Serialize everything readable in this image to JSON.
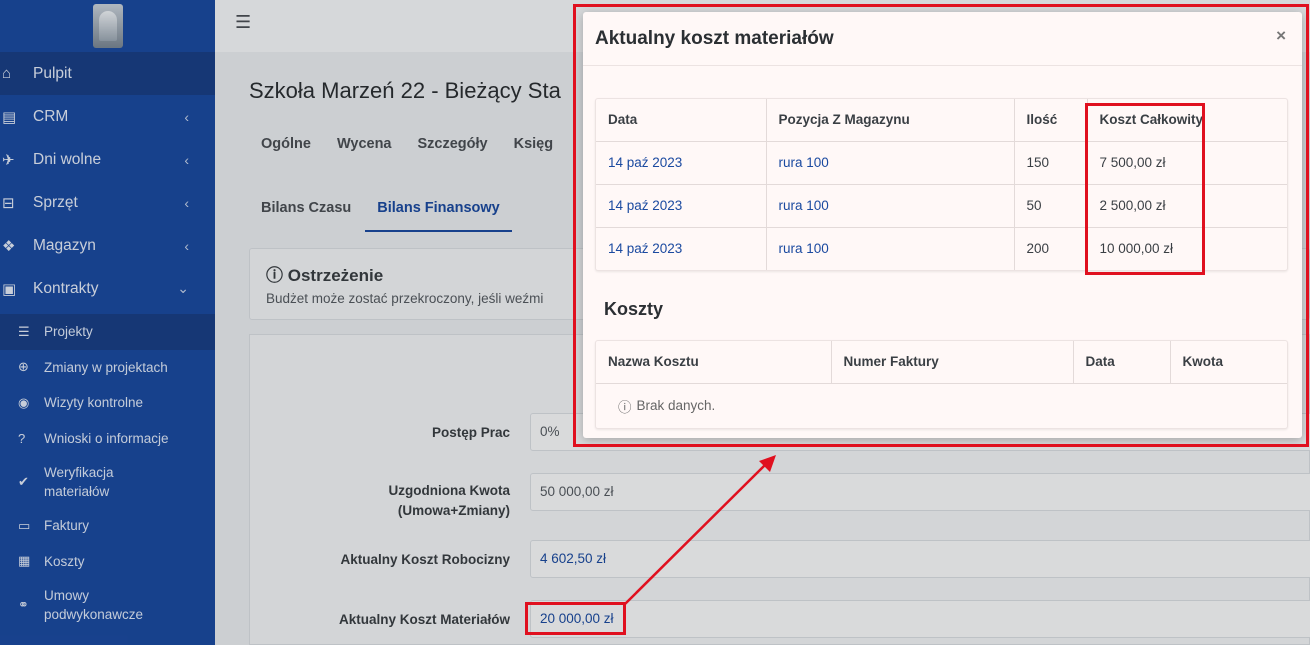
{
  "sidebar": {
    "items": [
      {
        "label": "Pulpit",
        "icon": "home-icon"
      },
      {
        "label": "CRM",
        "icon": "address-card-icon"
      },
      {
        "label": "Dni wolne",
        "icon": "plane-icon"
      },
      {
        "label": "Sprzęt",
        "icon": "hdd-icon"
      },
      {
        "label": "Magazyn",
        "icon": "cubes-icon"
      },
      {
        "label": "Kontrakty",
        "icon": "briefcase-icon"
      }
    ],
    "subitems": [
      {
        "label": "Projekty",
        "icon": "list-icon"
      },
      {
        "label": "Zmiany w projektach",
        "icon": "plus-circle-icon"
      },
      {
        "label": "Wizyty kontrolne",
        "icon": "eye-icon"
      },
      {
        "label": "Wnioski o informacje",
        "icon": "question-circle-icon"
      },
      {
        "label_1": "Weryfikacja",
        "label_2": "materiałów",
        "icon": "check-icon"
      },
      {
        "label": "Faktury",
        "icon": "money-icon"
      },
      {
        "label": "Koszty",
        "icon": "calculator-icon"
      },
      {
        "label_1": "Umowy",
        "label_2": "podwykonawcze",
        "icon": "handshake-icon"
      }
    ]
  },
  "page": {
    "title": "Szkoła Marzeń 22 - Bieżący Sta",
    "tabs1": [
      "Ogólne",
      "Wycena",
      "Szczegóły",
      "Księg"
    ],
    "tabs2": [
      "Bilans Czasu",
      "Bilans Finansowy"
    ],
    "warning": {
      "title": "Ostrzeżenie",
      "text": "Budżet może zostać przekroczony, jeśli weźmi"
    },
    "form": {
      "progress_label": "Postęp Prac",
      "progress_value": "0%",
      "agreed_label_1": "Uzgodniona Kwota",
      "agreed_label_2": "(Umowa+Zmiany)",
      "agreed_value": "50 000,00 zł",
      "labor_label": "Aktualny Koszt Robocizny",
      "labor_value": "4 602,50 zł",
      "material_label": "Aktualny Koszt Materiałów",
      "material_value": "20 000,00 zł"
    }
  },
  "modal": {
    "title": "Aktualny koszt materiałów",
    "close": "×",
    "materials_table": {
      "columns": [
        "Data",
        "Pozycja Z Magazynu",
        "Ilość",
        "Koszt Całkowity"
      ],
      "rows": [
        [
          "14 paź 2023",
          "rura 100",
          "150",
          "7 500,00 zł"
        ],
        [
          "14 paź 2023",
          "rura 100",
          "50",
          "2 500,00 zł"
        ],
        [
          "14 paź 2023",
          "rura 100",
          "200",
          "10 000,00 zł"
        ]
      ]
    },
    "costs_title": "Koszty",
    "costs_table": {
      "columns": [
        "Nazwa Kosztu",
        "Numer Faktury",
        "Data",
        "Kwota"
      ],
      "empty": "Brak danych."
    }
  },
  "colors": {
    "sidebar": "#1b4aa0",
    "link": "#1b4aa0",
    "highlight": "#e0101f"
  }
}
